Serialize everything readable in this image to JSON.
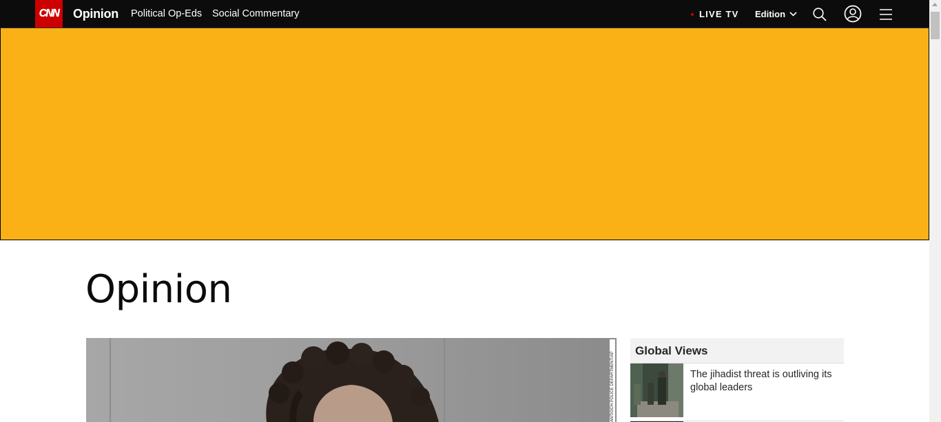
{
  "header": {
    "logo_text": "CNN",
    "section_title": "Opinion",
    "nav_links": [
      "Political Op-Eds",
      "Social Commentary"
    ],
    "live_tv": "LIVE TV",
    "edition": "Edition",
    "icons": [
      "search-icon",
      "account-icon",
      "hamburger-menu-icon",
      "chevron-down-icon"
    ],
    "brand_color": "#cc0000",
    "bar_color": "#0c0c0c"
  },
  "ad": {
    "color": "#f9b115"
  },
  "main": {
    "page_title": "Opinion",
    "hero_credit": "ANTIOCH POLICE DEPARTMENT/AP"
  },
  "global_views": {
    "title": "Global Views",
    "items": [
      {
        "headline": "The jihadist threat is outliving its global leaders"
      }
    ]
  }
}
